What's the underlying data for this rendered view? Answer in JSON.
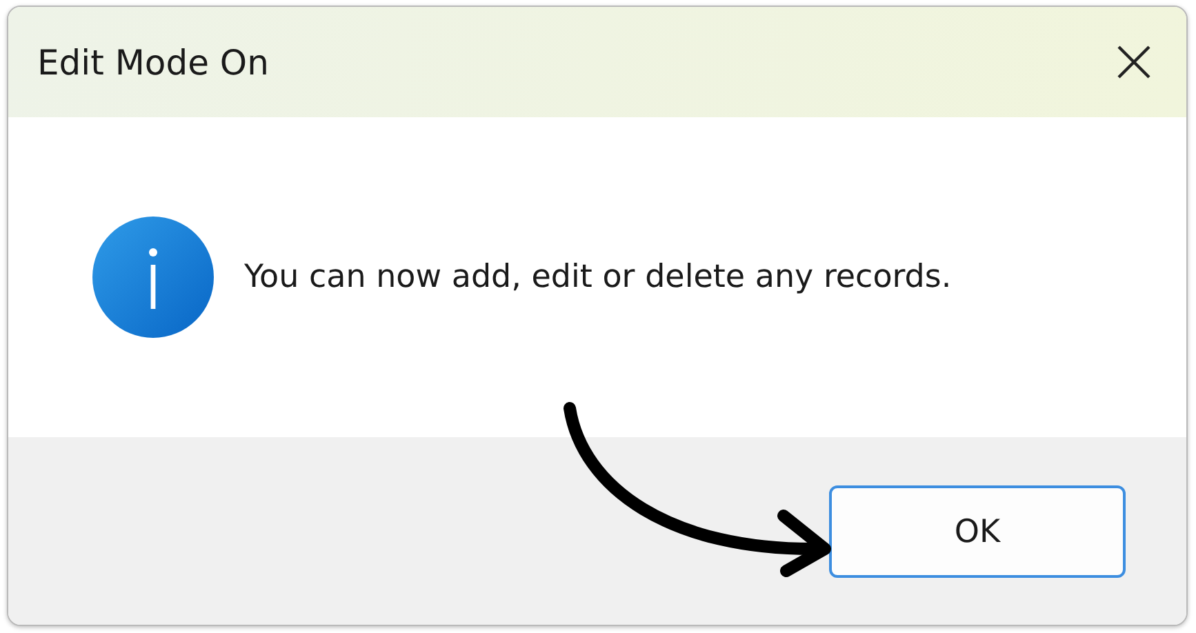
{
  "window": {
    "title": "Edit Mode On"
  },
  "message": {
    "kind": "info",
    "text": "You can now add, edit or delete any records."
  },
  "buttons": [
    {
      "label": "OK",
      "default": true
    }
  ]
}
